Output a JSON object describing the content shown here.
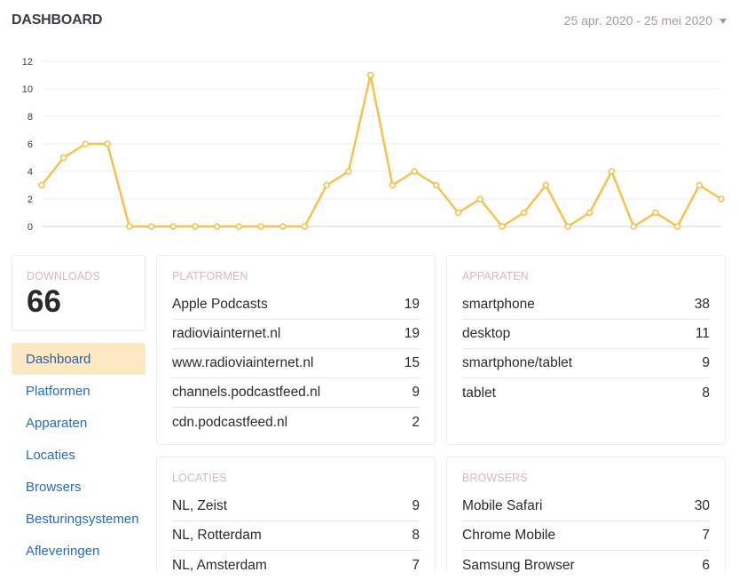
{
  "header": {
    "title": "DASHBOARD",
    "date_range": "25 apr. 2020 - 25 mei 2020"
  },
  "chart_data": {
    "type": "line",
    "title": "",
    "xlabel": "",
    "ylabel": "",
    "ylim": [
      0,
      12
    ],
    "yticks": [
      "0",
      "2",
      "4",
      "6",
      "8",
      "10",
      "12"
    ],
    "grid": true,
    "line_color": "#f7c14f",
    "values": [
      3,
      5,
      6,
      6,
      0,
      0,
      0,
      0,
      0,
      0,
      0,
      0,
      0,
      3,
      4,
      11,
      3,
      4,
      3,
      1,
      2,
      0,
      1,
      3,
      0,
      1,
      4,
      0,
      1,
      0,
      3,
      2
    ]
  },
  "downloads": {
    "label": "DOWNLOADS",
    "value": "66"
  },
  "nav": {
    "items": [
      {
        "label": "Dashboard"
      },
      {
        "label": "Platformen"
      },
      {
        "label": "Apparaten"
      },
      {
        "label": "Locaties"
      },
      {
        "label": "Browsers"
      },
      {
        "label": "Besturingsystemen"
      },
      {
        "label": "Afleveringen"
      }
    ]
  },
  "platformen": {
    "label": "PLATFORMEN",
    "rows": [
      {
        "name": "Apple Podcasts",
        "value": "19"
      },
      {
        "name": "radioviainternet.nl",
        "value": "19"
      },
      {
        "name": "www.radioviainternet.nl",
        "value": "15"
      },
      {
        "name": "channels.podcastfeed.nl",
        "value": "9"
      },
      {
        "name": "cdn.podcastfeed.nl",
        "value": "2"
      }
    ]
  },
  "apparaten": {
    "label": "APPARATEN",
    "rows": [
      {
        "name": "smartphone",
        "value": "38"
      },
      {
        "name": "desktop",
        "value": "11"
      },
      {
        "name": "smartphone/tablet",
        "value": "9"
      },
      {
        "name": "tablet",
        "value": "8"
      }
    ]
  },
  "locaties": {
    "label": "LOCATIES",
    "rows": [
      {
        "name": "NL, Zeist",
        "value": "9"
      },
      {
        "name": "NL, Rotterdam",
        "value": "8"
      },
      {
        "name": "NL, Amsterdam",
        "value": "7"
      }
    ]
  },
  "browsers": {
    "label": "BROWSERS",
    "rows": [
      {
        "name": "Mobile Safari",
        "value": "30"
      },
      {
        "name": "Chrome Mobile",
        "value": "7"
      },
      {
        "name": "Samsung Browser",
        "value": "6"
      }
    ]
  }
}
